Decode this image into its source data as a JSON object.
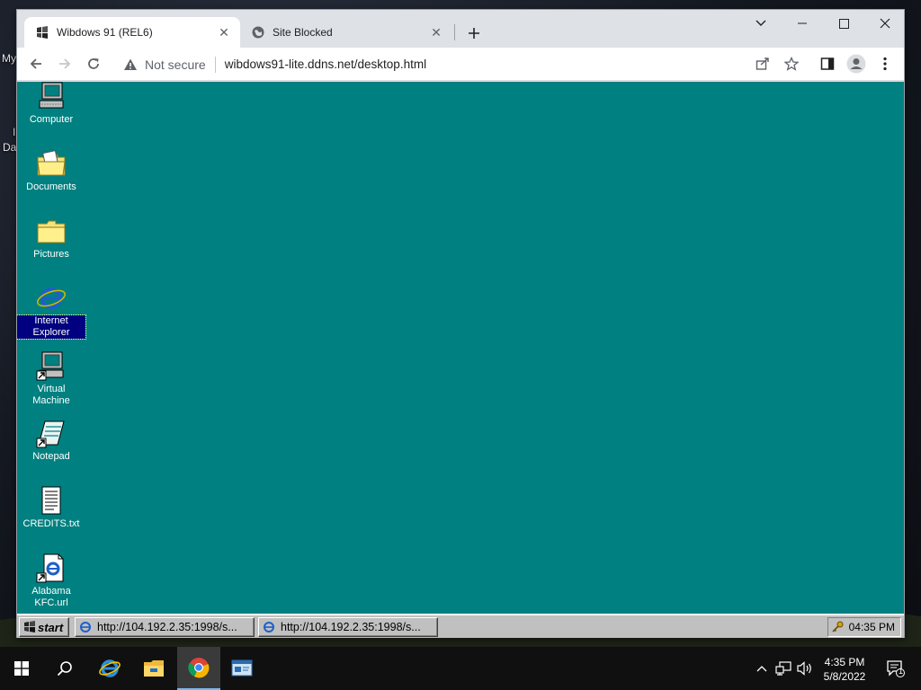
{
  "host_desktop": {
    "labels": [
      "My",
      "I",
      "Da"
    ]
  },
  "browser": {
    "tabs": [
      {
        "title": "Wibdows 91 (REL6)",
        "active": true
      },
      {
        "title": "Site Blocked",
        "active": false
      }
    ],
    "security_label": "Not secure",
    "url": "wibdows91-lite.ddns.net/desktop.html"
  },
  "retro_desktop": {
    "background_color": "#008080",
    "icons": [
      {
        "label": "Computer",
        "icon": "computer-icon"
      },
      {
        "label": "Documents",
        "icon": "documents-folder-icon"
      },
      {
        "label": "Pictures",
        "icon": "pictures-folder-icon"
      },
      {
        "label": "Internet Explorer",
        "icon": "internet-explorer-icon",
        "selected": true
      },
      {
        "label": "Virtual Machine",
        "icon": "virtual-machine-icon"
      },
      {
        "label": "Notepad",
        "icon": "notepad-icon"
      },
      {
        "label": "CREDITS.txt",
        "icon": "text-file-icon"
      },
      {
        "label": "Alabama KFC.url",
        "icon": "url-shortcut-icon"
      }
    ],
    "taskbar": {
      "start_label": "start",
      "windows": [
        {
          "label": "http://104.192.2.35:1998/s..."
        },
        {
          "label": "http://104.192.2.35:1998/s..."
        }
      ],
      "clock": "04:35 PM"
    }
  },
  "host_taskbar": {
    "time": "4:35 PM",
    "date": "5/8/2022",
    "notification_count": "1"
  }
}
